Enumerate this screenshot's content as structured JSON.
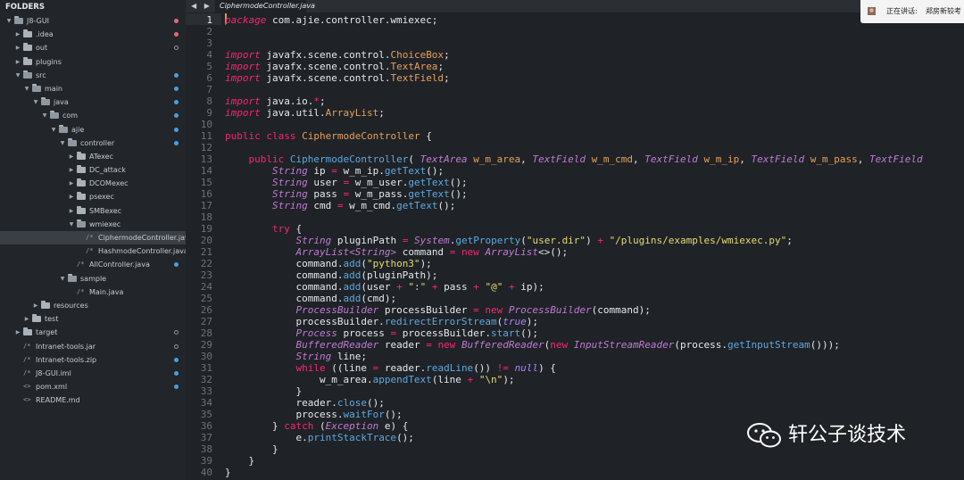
{
  "sidebar": {
    "header": "FOLDERS",
    "items": [
      {
        "label": "J8-GUI",
        "depth": 0,
        "kind": "folder",
        "open": true,
        "dot": "red"
      },
      {
        "label": ".idea",
        "depth": 1,
        "kind": "folder",
        "open": false,
        "dot": "red"
      },
      {
        "label": "out",
        "depth": 1,
        "kind": "folder",
        "open": false,
        "dot": "hollow"
      },
      {
        "label": "plugins",
        "depth": 1,
        "kind": "folder",
        "open": false,
        "dot": ""
      },
      {
        "label": "src",
        "depth": 1,
        "kind": "folder",
        "open": true,
        "dot": "blue"
      },
      {
        "label": "main",
        "depth": 2,
        "kind": "folder",
        "open": true,
        "dot": "blue"
      },
      {
        "label": "java",
        "depth": 3,
        "kind": "folder",
        "open": true,
        "dot": "blue"
      },
      {
        "label": "com",
        "depth": 4,
        "kind": "folder",
        "open": true,
        "dot": "blue"
      },
      {
        "label": "ajie",
        "depth": 5,
        "kind": "folder",
        "open": true,
        "dot": "blue"
      },
      {
        "label": "controller",
        "depth": 6,
        "kind": "folder",
        "open": true,
        "dot": "blue"
      },
      {
        "label": "ATexec",
        "depth": 7,
        "kind": "folder",
        "open": false,
        "dot": ""
      },
      {
        "label": "DC_attack",
        "depth": 7,
        "kind": "folder",
        "open": false,
        "dot": ""
      },
      {
        "label": "DCOMexec",
        "depth": 7,
        "kind": "folder",
        "open": false,
        "dot": ""
      },
      {
        "label": "psexec",
        "depth": 7,
        "kind": "folder",
        "open": false,
        "dot": ""
      },
      {
        "label": "SMBexec",
        "depth": 7,
        "kind": "folder",
        "open": false,
        "dot": ""
      },
      {
        "label": "wmiexec",
        "depth": 7,
        "kind": "folder",
        "open": true,
        "dot": ""
      },
      {
        "label": "CiphermodeController.java",
        "depth": 8,
        "kind": "file",
        "open": false,
        "dot": "",
        "selected": true
      },
      {
        "label": "HashmodeController.java",
        "depth": 8,
        "kind": "file",
        "open": false,
        "dot": ""
      },
      {
        "label": "AllController.java",
        "depth": 7,
        "kind": "file",
        "open": false,
        "dot": "blue"
      },
      {
        "label": "sample",
        "depth": 6,
        "kind": "folder",
        "open": true,
        "dot": ""
      },
      {
        "label": "Main.java",
        "depth": 7,
        "kind": "file",
        "open": false,
        "dot": ""
      },
      {
        "label": "resources",
        "depth": 3,
        "kind": "folder",
        "open": false,
        "dot": ""
      },
      {
        "label": "test",
        "depth": 2,
        "kind": "folder",
        "open": false,
        "dot": ""
      },
      {
        "label": "target",
        "depth": 1,
        "kind": "folder",
        "open": false,
        "dot": "hollow"
      },
      {
        "label": "Intranet-tools.jar",
        "depth": 1,
        "kind": "file",
        "open": false,
        "dot": "hollow"
      },
      {
        "label": "Intranet-tools.zip",
        "depth": 1,
        "kind": "file",
        "open": false,
        "dot": "blue"
      },
      {
        "label": "J8-GUI.iml",
        "depth": 1,
        "kind": "file",
        "open": false,
        "dot": "blue"
      },
      {
        "label": "pom.xml",
        "depth": 1,
        "kind": "code",
        "open": false,
        "dot": "blue"
      },
      {
        "label": "README.md",
        "depth": 1,
        "kind": "code",
        "open": false,
        "dot": ""
      }
    ]
  },
  "tabs": {
    "nav": "◀ ▶",
    "active_label": "CiphermodeController.java"
  },
  "notification": {
    "speaking_label": "正在讲话:",
    "speaker": "郑房新较考"
  },
  "watermark": {
    "text": "轩公子谈技术"
  },
  "editor": {
    "current_line": 1,
    "lines": [
      [
        [
          "kw",
          "package"
        ],
        [
          "var",
          " com.ajie.controller.wmiexec;"
        ]
      ],
      [],
      [],
      [
        [
          "kw",
          "import"
        ],
        [
          "var",
          " javafx.scene.control."
        ],
        [
          "cls",
          "ChoiceBox"
        ],
        [
          "var",
          ";"
        ]
      ],
      [
        [
          "kw",
          "import"
        ],
        [
          "var",
          " javafx.scene.control."
        ],
        [
          "cls",
          "TextArea"
        ],
        [
          "var",
          ";"
        ]
      ],
      [
        [
          "kw",
          "import"
        ],
        [
          "var",
          " javafx.scene.control."
        ],
        [
          "cls",
          "TextField"
        ],
        [
          "var",
          ";"
        ]
      ],
      [],
      [
        [
          "kw",
          "import"
        ],
        [
          "var",
          " java.io."
        ],
        [
          "op",
          "*"
        ],
        [
          "var",
          ";"
        ]
      ],
      [
        [
          "kw",
          "import"
        ],
        [
          "var",
          " java.util."
        ],
        [
          "cls",
          "ArrayList"
        ],
        [
          "var",
          ";"
        ]
      ],
      [],
      [
        [
          "kw2",
          "public"
        ],
        [
          "var",
          " "
        ],
        [
          "kw2",
          "class"
        ],
        [
          "var",
          " "
        ],
        [
          "cls",
          "CiphermodeController"
        ],
        [
          "var",
          " {"
        ]
      ],
      [],
      [
        [
          "var",
          "    "
        ],
        [
          "kw2",
          "public"
        ],
        [
          "var",
          " "
        ],
        [
          "fn",
          "CiphermodeController"
        ],
        [
          "var",
          "( "
        ],
        [
          "ty",
          "TextArea"
        ],
        [
          "var",
          " "
        ],
        [
          "cls",
          "w_m_area"
        ],
        [
          "var",
          ", "
        ],
        [
          "ty",
          "TextField"
        ],
        [
          "var",
          " "
        ],
        [
          "cls",
          "w_m_cmd"
        ],
        [
          "var",
          ", "
        ],
        [
          "ty",
          "TextField"
        ],
        [
          "var",
          " "
        ],
        [
          "cls",
          "w_m_ip"
        ],
        [
          "var",
          ", "
        ],
        [
          "ty",
          "TextField"
        ],
        [
          "var",
          " "
        ],
        [
          "cls",
          "w_m_pass"
        ],
        [
          "var",
          ", "
        ],
        [
          "ty",
          "TextField"
        ]
      ],
      [
        [
          "var",
          "        "
        ],
        [
          "ty",
          "String"
        ],
        [
          "var",
          " ip "
        ],
        [
          "op",
          "="
        ],
        [
          "var",
          " w_m_ip."
        ],
        [
          "fn",
          "getText"
        ],
        [
          "var",
          "();"
        ]
      ],
      [
        [
          "var",
          "        "
        ],
        [
          "ty",
          "String"
        ],
        [
          "var",
          " user "
        ],
        [
          "op",
          "="
        ],
        [
          "var",
          " w_m_user."
        ],
        [
          "fn",
          "getText"
        ],
        [
          "var",
          "();"
        ]
      ],
      [
        [
          "var",
          "        "
        ],
        [
          "ty",
          "String"
        ],
        [
          "var",
          " pass "
        ],
        [
          "op",
          "="
        ],
        [
          "var",
          " w_m_pass."
        ],
        [
          "fn",
          "getText"
        ],
        [
          "var",
          "();"
        ]
      ],
      [
        [
          "var",
          "        "
        ],
        [
          "ty",
          "String"
        ],
        [
          "var",
          " cmd "
        ],
        [
          "op",
          "="
        ],
        [
          "var",
          " w_m_cmd."
        ],
        [
          "fn",
          "getText"
        ],
        [
          "var",
          "();"
        ]
      ],
      [],
      [
        [
          "var",
          "        "
        ],
        [
          "kw2",
          "try"
        ],
        [
          "var",
          " {"
        ]
      ],
      [
        [
          "var",
          "            "
        ],
        [
          "ty",
          "String"
        ],
        [
          "var",
          " pluginPath "
        ],
        [
          "op",
          "="
        ],
        [
          "var",
          " "
        ],
        [
          "ty",
          "System"
        ],
        [
          "var",
          "."
        ],
        [
          "fn",
          "getProperty"
        ],
        [
          "var",
          "("
        ],
        [
          "str",
          "\"user.dir\""
        ],
        [
          "var",
          ") "
        ],
        [
          "op",
          "+"
        ],
        [
          "var",
          " "
        ],
        [
          "str",
          "\"/plugins/examples/wmiexec.py\""
        ],
        [
          "var",
          ";"
        ]
      ],
      [
        [
          "var",
          "            "
        ],
        [
          "ty",
          "ArrayList<String>"
        ],
        [
          "var",
          " command "
        ],
        [
          "op",
          "="
        ],
        [
          "var",
          " "
        ],
        [
          "kw2",
          "new"
        ],
        [
          "var",
          " "
        ],
        [
          "ty",
          "ArrayList"
        ],
        [
          "var",
          "<>();"
        ]
      ],
      [
        [
          "var",
          "            command."
        ],
        [
          "fn",
          "add"
        ],
        [
          "var",
          "("
        ],
        [
          "str",
          "\"python3\""
        ],
        [
          "var",
          ");"
        ]
      ],
      [
        [
          "var",
          "            command."
        ],
        [
          "fn",
          "add"
        ],
        [
          "var",
          "(pluginPath);"
        ]
      ],
      [
        [
          "var",
          "            command."
        ],
        [
          "fn",
          "add"
        ],
        [
          "var",
          "(user "
        ],
        [
          "op",
          "+"
        ],
        [
          "var",
          " "
        ],
        [
          "str",
          "\":\""
        ],
        [
          "var",
          " "
        ],
        [
          "op",
          "+"
        ],
        [
          "var",
          " pass "
        ],
        [
          "op",
          "+"
        ],
        [
          "var",
          " "
        ],
        [
          "str",
          "\"@\""
        ],
        [
          "var",
          " "
        ],
        [
          "op",
          "+"
        ],
        [
          "var",
          " ip);"
        ]
      ],
      [
        [
          "var",
          "            command."
        ],
        [
          "fn",
          "add"
        ],
        [
          "var",
          "(cmd);"
        ]
      ],
      [
        [
          "var",
          "            "
        ],
        [
          "ty",
          "ProcessBuilder"
        ],
        [
          "var",
          " processBuilder "
        ],
        [
          "op",
          "="
        ],
        [
          "var",
          " "
        ],
        [
          "kw2",
          "new"
        ],
        [
          "var",
          " "
        ],
        [
          "ty",
          "ProcessBuilder"
        ],
        [
          "var",
          "(command);"
        ]
      ],
      [
        [
          "var",
          "            processBuilder."
        ],
        [
          "fn",
          "redirectErrorStream"
        ],
        [
          "var",
          "("
        ],
        [
          "lit",
          "true"
        ],
        [
          "var",
          ");"
        ]
      ],
      [
        [
          "var",
          "            "
        ],
        [
          "ty",
          "Process"
        ],
        [
          "var",
          " process "
        ],
        [
          "op",
          "="
        ],
        [
          "var",
          " processBuilder."
        ],
        [
          "fn",
          "start"
        ],
        [
          "var",
          "();"
        ]
      ],
      [
        [
          "var",
          "            "
        ],
        [
          "ty",
          "BufferedReader"
        ],
        [
          "var",
          " reader "
        ],
        [
          "op",
          "="
        ],
        [
          "var",
          " "
        ],
        [
          "kw2",
          "new"
        ],
        [
          "var",
          " "
        ],
        [
          "ty",
          "BufferedReader"
        ],
        [
          "var",
          "("
        ],
        [
          "kw2",
          "new"
        ],
        [
          "var",
          " "
        ],
        [
          "ty",
          "InputStreamReader"
        ],
        [
          "var",
          "(process."
        ],
        [
          "fn",
          "getInputStream"
        ],
        [
          "var",
          "()));"
        ]
      ],
      [
        [
          "var",
          "            "
        ],
        [
          "ty",
          "String"
        ],
        [
          "var",
          " line;"
        ]
      ],
      [
        [
          "var",
          "            "
        ],
        [
          "kw2",
          "while"
        ],
        [
          "var",
          " ((line "
        ],
        [
          "op",
          "="
        ],
        [
          "var",
          " reader."
        ],
        [
          "fn",
          "readLine"
        ],
        [
          "var",
          "()) "
        ],
        [
          "op",
          "!="
        ],
        [
          "var",
          " "
        ],
        [
          "lit",
          "null"
        ],
        [
          "var",
          ") {"
        ]
      ],
      [
        [
          "var",
          "                w_m_area."
        ],
        [
          "fn",
          "appendText"
        ],
        [
          "var",
          "(line "
        ],
        [
          "op",
          "+"
        ],
        [
          "var",
          " "
        ],
        [
          "str",
          "\"\\n\""
        ],
        [
          "var",
          ");"
        ]
      ],
      [
        [
          "var",
          "            }"
        ]
      ],
      [
        [
          "var",
          "            reader."
        ],
        [
          "fn",
          "close"
        ],
        [
          "var",
          "();"
        ]
      ],
      [
        [
          "var",
          "            process."
        ],
        [
          "fn",
          "waitFor"
        ],
        [
          "var",
          "();"
        ]
      ],
      [
        [
          "var",
          "        } "
        ],
        [
          "kw2",
          "catch"
        ],
        [
          "var",
          " ("
        ],
        [
          "ty",
          "Exception"
        ],
        [
          "var",
          " e) {"
        ]
      ],
      [
        [
          "var",
          "            e."
        ],
        [
          "fn",
          "printStackTrace"
        ],
        [
          "var",
          "();"
        ]
      ],
      [
        [
          "var",
          "        }"
        ]
      ],
      [
        [
          "var",
          "    }"
        ]
      ],
      [
        [
          "var",
          "}"
        ]
      ]
    ]
  },
  "colors": {
    "editor_bg": "#1f2226",
    "sidebar_bg": "#22262a",
    "keyword": "#f92672",
    "type": "#c07bd6",
    "string": "#e6db74",
    "function": "#5da9e3",
    "class": "#e6a15b"
  }
}
